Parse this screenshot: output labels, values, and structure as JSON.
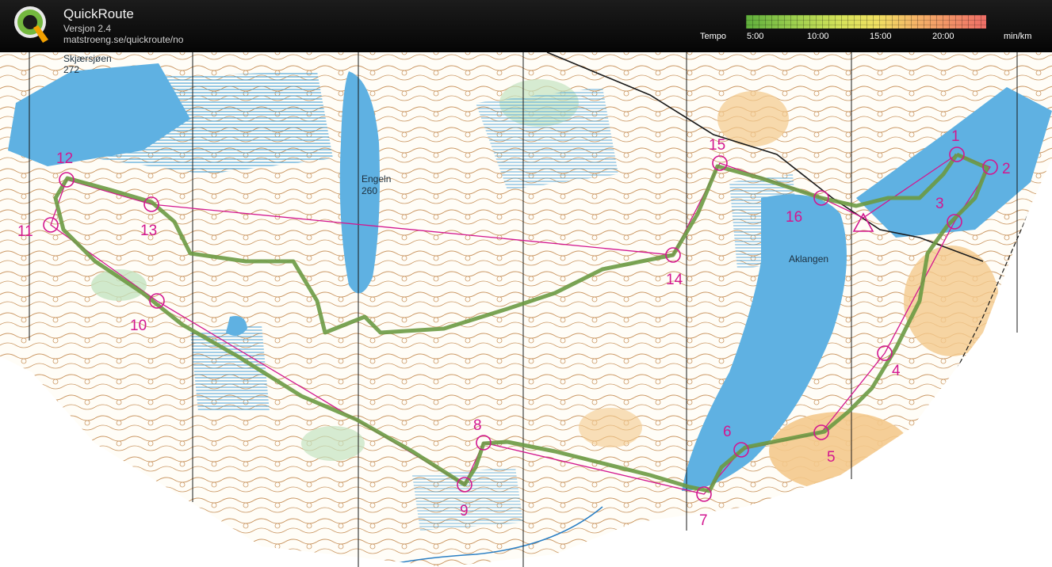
{
  "app": {
    "title": "QuickRoute",
    "version": "Versjon 2.4",
    "url": "matstroeng.se/quickroute/no",
    "logo_letter": "Q"
  },
  "legend": {
    "label": "Tempo",
    "unit": "min/km",
    "ticks": [
      "5:00",
      "10:00",
      "15:00",
      "20:00"
    ],
    "colors": [
      "#5fae3c",
      "#9ccf4e",
      "#d7e35a",
      "#f0df62",
      "#f4b067",
      "#ee6d66"
    ]
  },
  "map": {
    "lakes": [
      {
        "name": "Skjærsjøen",
        "height": "272"
      },
      {
        "name": "Engeln",
        "height": "260"
      },
      {
        "name": "Aklangen"
      }
    ],
    "controls": [
      "1",
      "2",
      "3",
      "4",
      "5",
      "6",
      "7",
      "8",
      "9",
      "10",
      "11",
      "12",
      "13",
      "14",
      "15",
      "16"
    ],
    "colors": {
      "course": "#d3178f",
      "route": "#6b9a42",
      "water": "#5fb1e2",
      "marsh": "#3d9cd6",
      "contour": "#b87430",
      "open": "#f4c98c",
      "green": "#c4e3c1"
    }
  }
}
